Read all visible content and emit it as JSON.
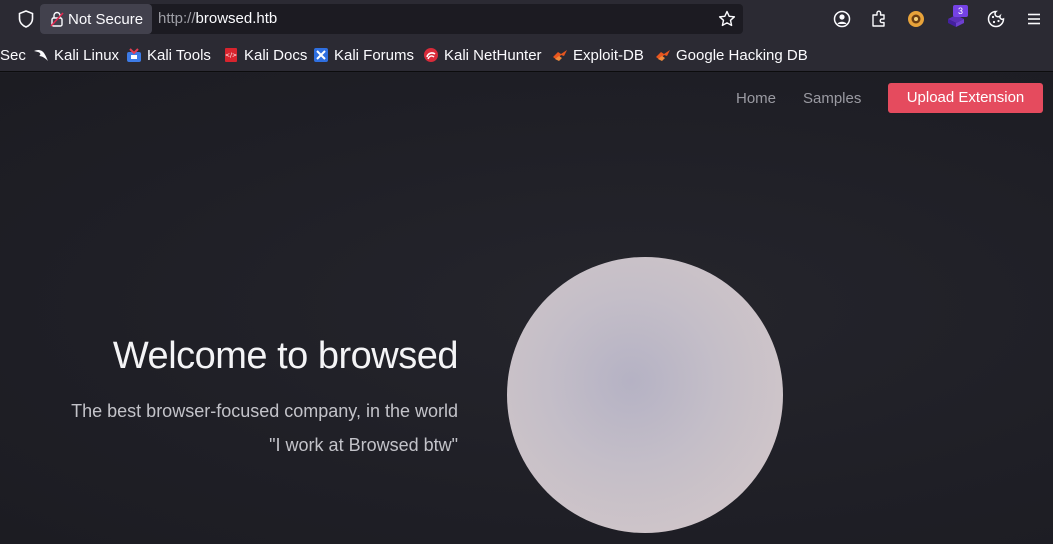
{
  "browser": {
    "security_label": "Not Secure",
    "url_protocol": "http://",
    "url_host": "browsed.htb",
    "extension_badge": "3",
    "icons": [
      "shield-icon",
      "lock-icon",
      "bookmark-star-icon",
      "account-icon",
      "extensions-icon",
      "foxyproxy-icon",
      "extension-icon",
      "cookie-icon",
      "menu-icon"
    ]
  },
  "bookmarks": [
    {
      "label": "Sec",
      "icon": "none"
    },
    {
      "label": "Kali Linux",
      "icon": "kali-dragon-icon"
    },
    {
      "label": "Kali Tools",
      "icon": "kali-tools-icon"
    },
    {
      "label": "Kali Docs",
      "icon": "kali-docs-icon"
    },
    {
      "label": "Kali Forums",
      "icon": "kali-forums-icon"
    },
    {
      "label": "Kali NetHunter",
      "icon": "nethunter-icon"
    },
    {
      "label": "Exploit-DB",
      "icon": "exploit-db-icon"
    },
    {
      "label": "Google Hacking DB",
      "icon": "ghdb-icon"
    }
  ],
  "site": {
    "nav": {
      "home": "Home",
      "samples": "Samples",
      "upload": "Upload Extension"
    },
    "hero": {
      "title": "Welcome to browsed",
      "subtitle": "The best browser-focused company, in the world",
      "quote": "\"I work at Browsed btw\""
    }
  },
  "colors": {
    "accent": "#e54b5e",
    "background": "#1f1f26",
    "toolbar": "#2b2a33"
  }
}
